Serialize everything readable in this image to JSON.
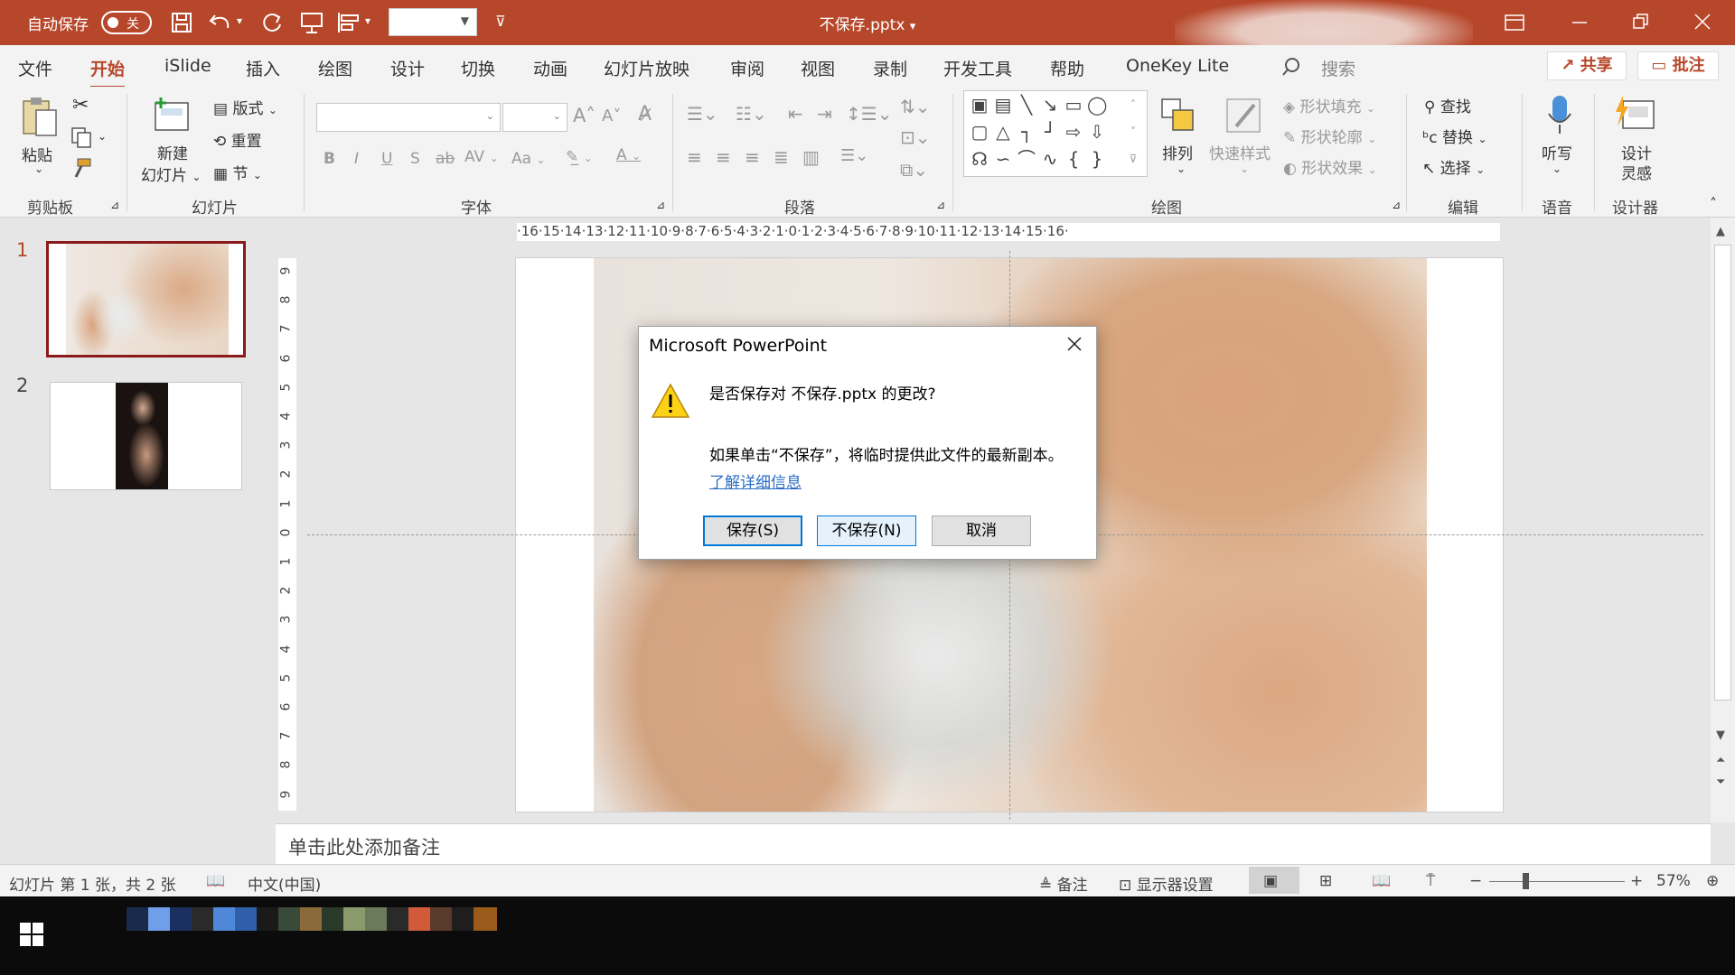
{
  "titlebar": {
    "autosave_label": "自动保存",
    "autosave_state": "关",
    "document_title": "不保存.pptx",
    "title_dropdown": "▾"
  },
  "tabs": [
    "文件",
    "开始",
    "iSlide",
    "插入",
    "绘图",
    "设计",
    "切换",
    "动画",
    "幻灯片放映",
    "审阅",
    "视图",
    "录制",
    "开发工具",
    "帮助",
    "OneKey Lite"
  ],
  "active_tab": "开始",
  "search_label": "搜索",
  "share_label": "共享",
  "comment_label": "批注",
  "ribbon": {
    "clipboard": {
      "paste": "粘贴",
      "group": "剪贴板"
    },
    "slides": {
      "new_slide_line1": "新建",
      "new_slide_line2": "幻灯片",
      "layout": "版式",
      "reset": "重置",
      "section": "节",
      "group": "幻灯片"
    },
    "font": {
      "group": "字体",
      "bold": "B",
      "italic": "I",
      "underline": "U",
      "shadow": "S",
      "strike": "ab",
      "spacing": "AV",
      "case": "Aa",
      "grow": "A",
      "shrink": "A",
      "color": "A"
    },
    "paragraph": {
      "group": "段落"
    },
    "drawing": {
      "arrange": "排列",
      "quick_styles": "快速样式",
      "fill": "形状填充",
      "outline": "形状轮廓",
      "effects": "形状效果",
      "group": "绘图"
    },
    "editing": {
      "find": "查找",
      "replace": "替换",
      "select": "选择",
      "group": "编辑"
    },
    "voice": {
      "dictate": "听写",
      "group": "语音"
    },
    "designer": {
      "line1": "设计",
      "line2": "灵感",
      "group": "设计器"
    }
  },
  "slides_panel": [
    {
      "number": "1",
      "selected": true
    },
    {
      "number": "2",
      "selected": false
    }
  ],
  "ruler": {
    "horizontal": "·16·15·14·13·12·11·10·9·8·7·6·5·4·3·2·1·0·1·2·3·4·5·6·7·8·9·10·11·12·13·14·15·16·",
    "vertical": [
      "9",
      "8",
      "7",
      "6",
      "5",
      "4",
      "3",
      "2",
      "1",
      "0",
      "1",
      "2",
      "3",
      "4",
      "5",
      "6",
      "7",
      "8",
      "9"
    ]
  },
  "notes_placeholder": "单击此处添加备注",
  "statusbar": {
    "slide_info": "幻灯片 第 1 张，共 2 张",
    "language": "中文(中国)",
    "notes": "备注",
    "display_settings": "显示器设置",
    "zoom_minus": "−",
    "zoom_plus": "+",
    "zoom": "57%"
  },
  "dialog": {
    "title": "Microsoft PowerPoint",
    "question": "是否保存对 不保存.pptx 的更改?",
    "info": "如果单击“不保存”，将临时提供此文件的最新副本。",
    "link": "了解详细信息",
    "save": "保存(S)",
    "dont_save": "不保存(N)",
    "cancel": "取消"
  },
  "colors": {
    "accent": "#b7472a",
    "link": "#2a6dc6",
    "focus": "#0078d7"
  }
}
